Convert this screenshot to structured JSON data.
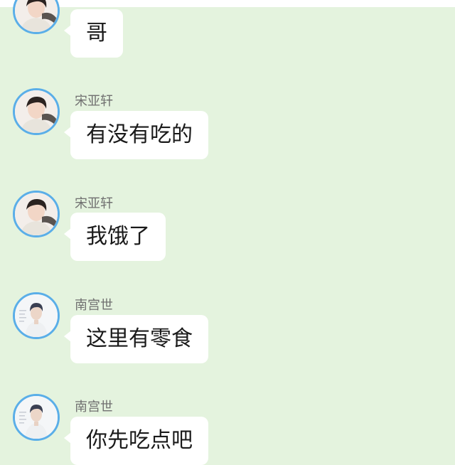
{
  "chat": {
    "messages": [
      {
        "sender": "",
        "text": "哥",
        "avatar": "avatar-a"
      },
      {
        "sender": "宋亚轩",
        "text": "有没有吃的",
        "avatar": "avatar-a"
      },
      {
        "sender": "宋亚轩",
        "text": "我饿了",
        "avatar": "avatar-a"
      },
      {
        "sender": "南宫世",
        "text": "这里有零食",
        "avatar": "avatar-b"
      },
      {
        "sender": "南宫世",
        "text": "你先吃点吧",
        "avatar": "avatar-b"
      }
    ]
  },
  "colors": {
    "background": "#e4f3de",
    "bubble": "#ffffff",
    "avatar_border": "#5aaee8",
    "sender_text": "#707070"
  }
}
